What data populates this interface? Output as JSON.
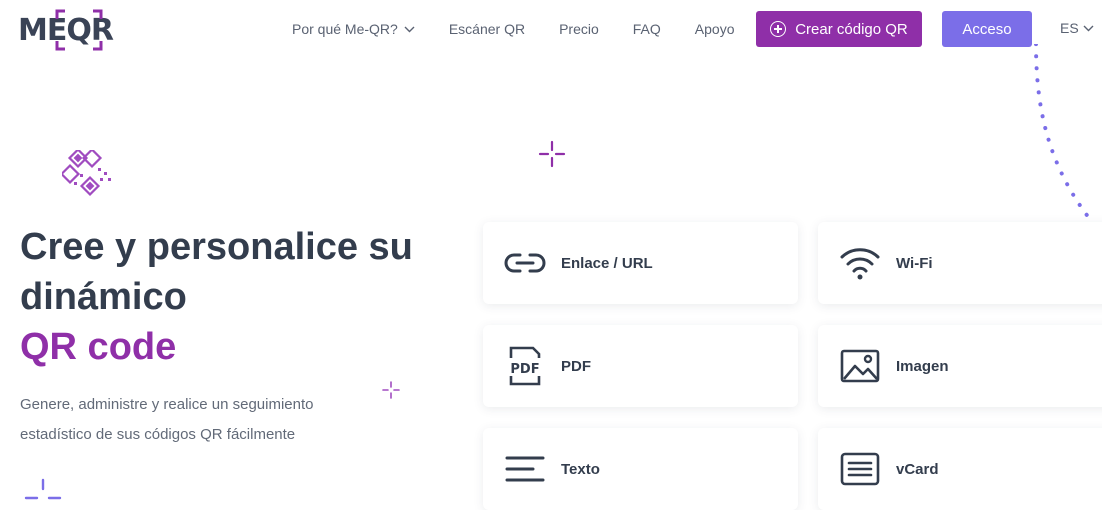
{
  "header": {
    "logo_letters": "ME",
    "logo_qr": "QR",
    "nav": [
      {
        "label": "Por qué Me-QR?",
        "has_dropdown": true
      },
      {
        "label": "Escáner QR"
      },
      {
        "label": "Precio"
      },
      {
        "label": "FAQ"
      },
      {
        "label": "Apoyo"
      }
    ],
    "create_button": "Crear código QR",
    "login_button": "Acceso",
    "language": "ES"
  },
  "hero": {
    "title_line1": "Cree y personalice su",
    "title_line2": "dinámico",
    "title_accent": "QR code",
    "subtitle": "Genere, administre y realice un seguimiento estadístico de sus códigos QR fácilmente"
  },
  "qr_types": [
    {
      "label": "Enlace / URL",
      "icon": "link-icon"
    },
    {
      "label": "Wi-Fi",
      "icon": "wifi-icon"
    },
    {
      "label": "PDF",
      "icon": "pdf-icon"
    },
    {
      "label": "Imagen",
      "icon": "image-icon"
    },
    {
      "label": "Texto",
      "icon": "text-icon"
    },
    {
      "label": "vCard",
      "icon": "vcard-icon"
    }
  ],
  "colors": {
    "brand_purple": "#8f2fa8",
    "login_violet": "#7b6ee8",
    "text_dark": "#333d4d",
    "dotted_arc": "#7b6ee8"
  }
}
